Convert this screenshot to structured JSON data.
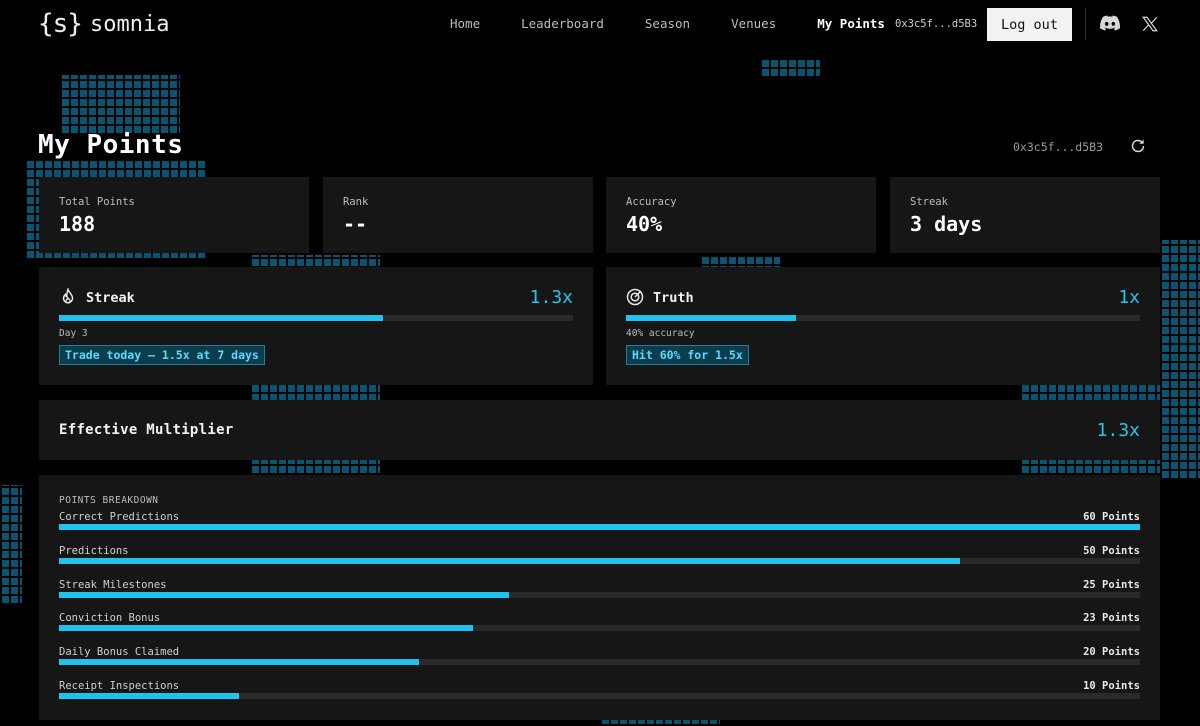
{
  "nav": {
    "logo_mark": "{s}",
    "logo_text": "somnia",
    "links": [
      "Home",
      "Leaderboard",
      "Season",
      "Venues",
      "My Points"
    ],
    "active_link": "My Points",
    "wallet": "0x3c5f...d5B3",
    "logout_label": "Log out",
    "icons": [
      "discord-icon",
      "x-icon"
    ]
  },
  "header": {
    "title": "My Points",
    "wallet": "0x3c5f...d5B3",
    "refresh_icon": "refresh-icon"
  },
  "stats": [
    {
      "label": "Total Points",
      "value": "188"
    },
    {
      "label": "Rank",
      "value": "--"
    },
    {
      "label": "Accuracy",
      "value": "40%"
    },
    {
      "label": "Streak",
      "value": "3 days"
    }
  ],
  "multipliers": {
    "streak": {
      "title": "Streak",
      "icon": "flame-icon",
      "value": "1.3x",
      "progress": 0.63,
      "subtitle": "Day 3",
      "badge": "Trade today — 1.5x at 7 days"
    },
    "truth": {
      "title": "Truth",
      "icon": "target-icon",
      "value": "1x",
      "progress": 0.33,
      "subtitle": "40% accuracy",
      "badge": "Hit 60% for 1.5x"
    }
  },
  "effective": {
    "label": "Effective Multiplier",
    "value": "1.3x"
  },
  "breakdown": {
    "title": "POINTS BREAKDOWN",
    "rows": [
      {
        "label": "Correct Predictions",
        "points": "60 Points",
        "value": 60
      },
      {
        "label": "Predictions",
        "points": "50 Points",
        "value": 50
      },
      {
        "label": "Streak Milestones",
        "points": "25 Points",
        "value": 25
      },
      {
        "label": "Conviction Bonus",
        "points": "23 Points",
        "value": 23
      },
      {
        "label": "Daily Bonus Claimed",
        "points": "20 Points",
        "value": 20
      },
      {
        "label": "Receipt Inspections",
        "points": "10 Points",
        "value": 10
      }
    ]
  },
  "colors": {
    "accent": "#1fc3ec",
    "background": "#000000",
    "card": "#161616"
  }
}
